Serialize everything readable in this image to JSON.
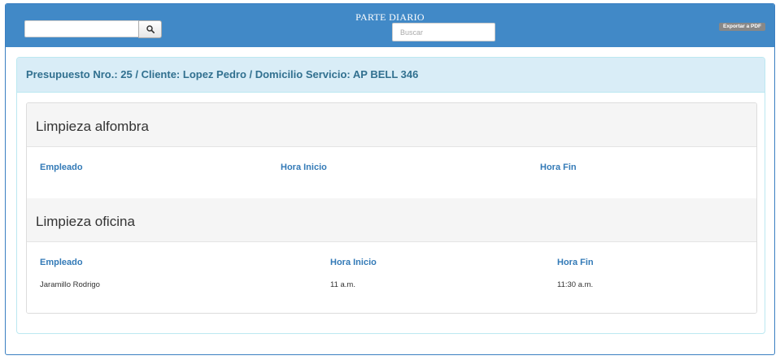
{
  "topbar": {
    "title": "PARTE DIARIO",
    "search_value": "",
    "buscar_placeholder": "Buscar",
    "export_label": "Exportar a PDF",
    "color": "#4189c7"
  },
  "header": {
    "text": "Presupuesto Nro.: 25 / Cliente: Lopez Pedro / Domicilio Servicio: AP BELL 346"
  },
  "sections": [
    {
      "title": "Limpieza alfombra",
      "columns": [
        "Empleado",
        "Hora Inicio",
        "Hora Fin"
      ],
      "rows": []
    },
    {
      "title": "Limpieza oficina",
      "columns": [
        "Empleado",
        "Hora Inicio",
        "Hora Fin"
      ],
      "rows": [
        [
          "Jaramillo Rodrigo",
          "11 a.m.",
          "11:30 a.m."
        ]
      ]
    }
  ]
}
